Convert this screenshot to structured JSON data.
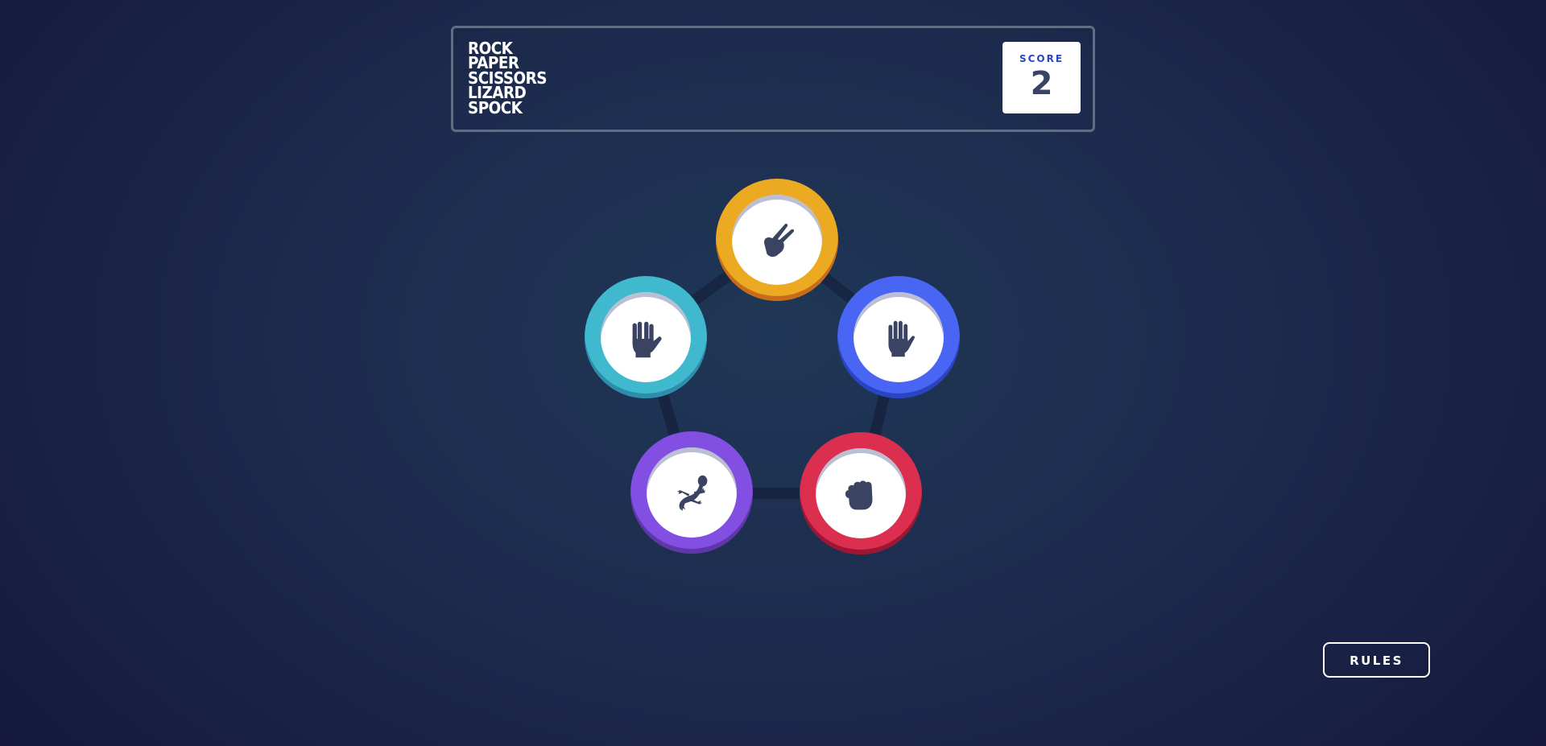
{
  "header": {
    "title_lines": [
      "ROCK",
      "PAPER",
      "SCISSORS",
      "LIZARD",
      "SPOCK"
    ],
    "score": {
      "label": "SCORE",
      "value": "2"
    }
  },
  "board": {
    "tokens": [
      {
        "id": "scissors",
        "icon": "scissors-hand-icon",
        "color": "#eca922"
      },
      {
        "id": "spock",
        "icon": "spock-hand-icon",
        "color": "#40b9ce"
      },
      {
        "id": "paper",
        "icon": "paper-hand-icon",
        "color": "#4865f4"
      },
      {
        "id": "lizard",
        "icon": "lizard-icon",
        "color": "#834fe3"
      },
      {
        "id": "rock",
        "icon": "rock-fist-icon",
        "color": "#dc2e4e"
      }
    ]
  },
  "footer": {
    "rules_label": "RULES"
  },
  "colors": {
    "background_dark": "#141539",
    "background_light": "#1f3756",
    "header_border": "#606e85",
    "score_label": "#2a46c0",
    "score_value": "#3b4363",
    "icon_fill": "#3b4363"
  }
}
